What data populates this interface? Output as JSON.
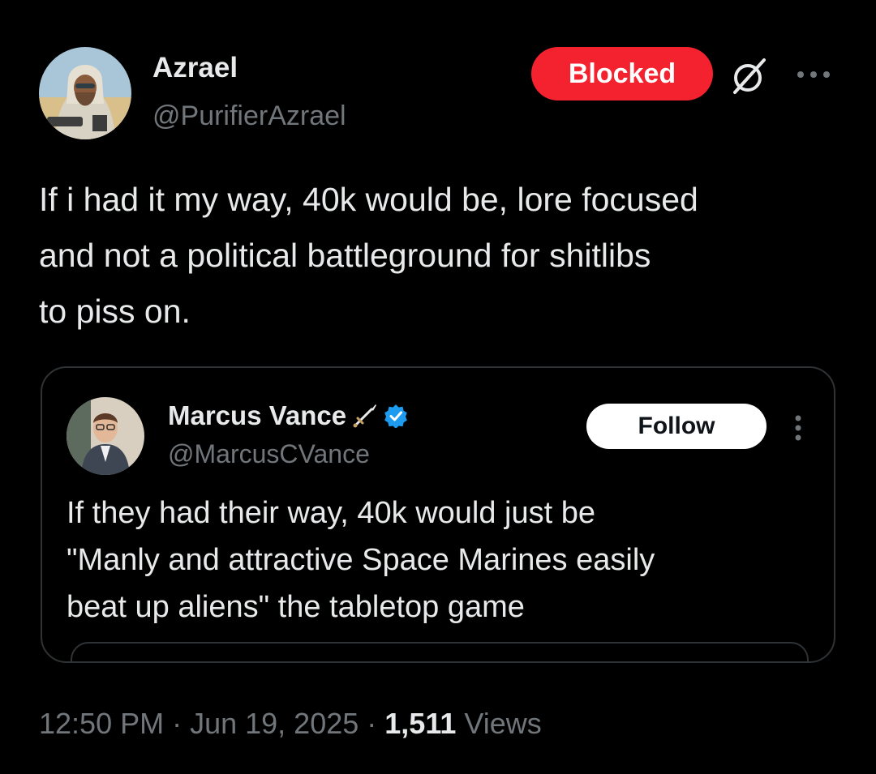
{
  "author": {
    "name": "Azrael",
    "handle": "@PurifierAzrael"
  },
  "blocked_label": "Blocked",
  "post_text": "If i had it my way, 40k would be, lore focused\nand not a political battleground for shitlibs\nto piss on.",
  "quote": {
    "name": "Marcus Vance",
    "handle": "@MarcusCVance",
    "follow_label": "Follow",
    "text": "If they had their way, 40k would just be\n\"Manly and attractive Space Marines easily\nbeat up aliens\" the tabletop game"
  },
  "meta": {
    "time": "12:50 PM",
    "separator": " · ",
    "date": "Jun 19, 2025",
    "views_count": "1,511",
    "views_label": " Views"
  },
  "icons": {
    "grok": "grok-icon",
    "more": "more-icon",
    "verified": "verified-badge-icon",
    "sword": "sword-icon"
  },
  "colors": {
    "background": "#000000",
    "text": "#e7e9ea",
    "muted": "#71767b",
    "blocked": "#f4212e",
    "verified": "#1d9bf0",
    "border": "#2f3336"
  }
}
